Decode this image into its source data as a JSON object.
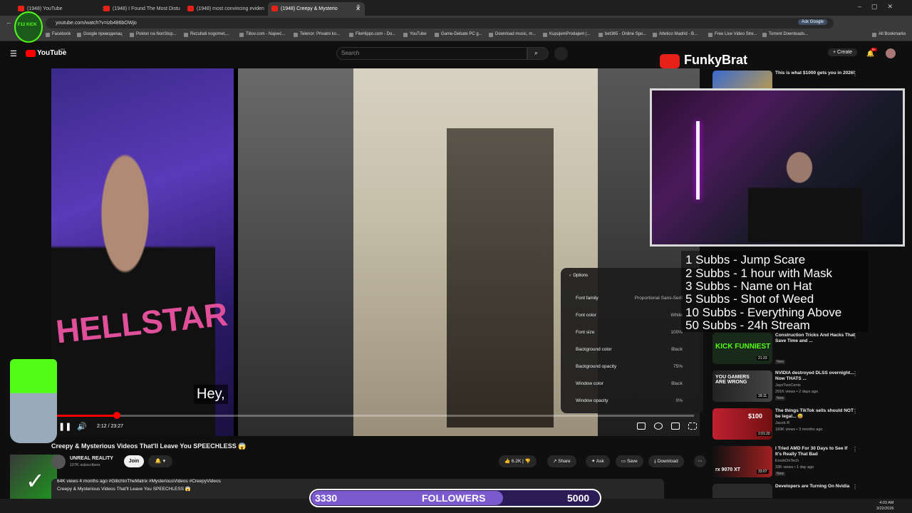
{
  "browser": {
    "tabs": [
      {
        "title": "(1948) YouTube"
      },
      {
        "title": "(1948) I Found The Most Distu"
      },
      {
        "title": "(1948) most convincing eviden"
      },
      {
        "title": "(1948) Creepy & Mysterio"
      }
    ],
    "url": "youtube.com/watch?v=izb486bOWjo",
    "ask_google": "Ask Google",
    "bookmarks": [
      "Facebook",
      "Google преводилац",
      "Poklon na NonStop...",
      "Rezultati nogomet,...",
      "Tiitov.com - Najveć...",
      "Telenor: Privatni ko...",
      "FileHippo.com - Do...",
      "YouTube",
      "Game-Debate PC g...",
      "Download music, m...",
      "KupujemProdajem |...",
      "bet365 - Online Spo...",
      "Atletico Madrid - B...",
      "Free Live Video Stre...",
      "Torrent Downloads..."
    ],
    "all_bookmarks": "All Bookmarks"
  },
  "youtube": {
    "logo": "YouTube",
    "logo_region": "RS",
    "search_placeholder": "Search",
    "create": "Create",
    "notifications": "9+"
  },
  "video": {
    "shirt_text": "HELLSTAR",
    "caption": "Hey,",
    "time": "2:12 / 23:27",
    "progress_fraction": 0.094,
    "options": {
      "title": "Options",
      "rows": [
        {
          "label": "Font family",
          "value": "Proportional Sans-Serif"
        },
        {
          "label": "Font color",
          "value": "White"
        },
        {
          "label": "Font size",
          "value": "100%"
        },
        {
          "label": "Background color",
          "value": "Black"
        },
        {
          "label": "Background opacity",
          "value": "75%"
        },
        {
          "label": "Window color",
          "value": "Black"
        },
        {
          "label": "Window opacity",
          "value": "0%"
        }
      ]
    }
  },
  "info": {
    "title": "Creepy & Mysterious Videos That'll Leave You SPEECHLESS 😱",
    "channel": "UNREAL REALITY",
    "subscribers": "107K subscribers",
    "join": "Join",
    "likes": "6.2K",
    "share": "Share",
    "ask": "Ask",
    "save": "Save",
    "download": "Download",
    "meta_line": "64K views  4 months ago  #GlitchInTheMatrix #MysteriousVideos #CreepyVideos",
    "meta_desc": "Creepy & Mysterious Videos That'll Leave You SPEECHLESS 😱"
  },
  "recommendations": [
    {
      "title": "This is what $1000 gets you in 2026!",
      "channel": "",
      "meta": "",
      "duration": ""
    },
    {
      "title": "Construction Tricks And Hacks That Save Time and ...",
      "channel": "",
      "meta": "",
      "duration": "21:23",
      "thumb_text": "KICK FUNNIEST",
      "new": "New"
    },
    {
      "title": "NVIDIA destroyed DLSS overnight... Now THATS ...",
      "channel": "JayzTwoCents",
      "meta": "291K views • 2 days ago",
      "duration": "18:11",
      "thumb_text": "YOU GAMERS ARE WRONG",
      "new": "New"
    },
    {
      "title": "The things TikTok sells should NOT be legal... 😅",
      "channel": "Jacob R",
      "meta": "183K views • 3 months ago",
      "duration": "2:01:20",
      "thumb_text": "$100"
    },
    {
      "title": "I Tried AMD For 30 Days to See If It's Really That Bad",
      "channel": "ErockOnTech",
      "meta": "33K views • 1 day ago",
      "duration": "33:07",
      "thumb_text": "rx 9070 XT",
      "new": "New"
    },
    {
      "title": "Developers are Turning On Nvidia",
      "channel": "",
      "meta": "",
      "duration": ""
    }
  ],
  "overlay": {
    "streamer": "FunkyBrat",
    "sub_goals": [
      "1 Subbs - Jump Scare",
      "2 Subbs - 1 hour with Mask",
      "3 Subbs - Name on Hat",
      "5 Subbs - Shot of Weed",
      "10 Subbs - Everything Above",
      "50 Subbs - 24h Stream"
    ],
    "followers_current": "3330",
    "followers_label": "FOLLOWERS",
    "followers_goal": "5000",
    "followers_fraction": 0.666,
    "kick_badge": "F12 KICK",
    "accent_color": "#53fc18"
  },
  "taskbar": {
    "time": "4:03 AM",
    "date": "3/22/2026"
  }
}
